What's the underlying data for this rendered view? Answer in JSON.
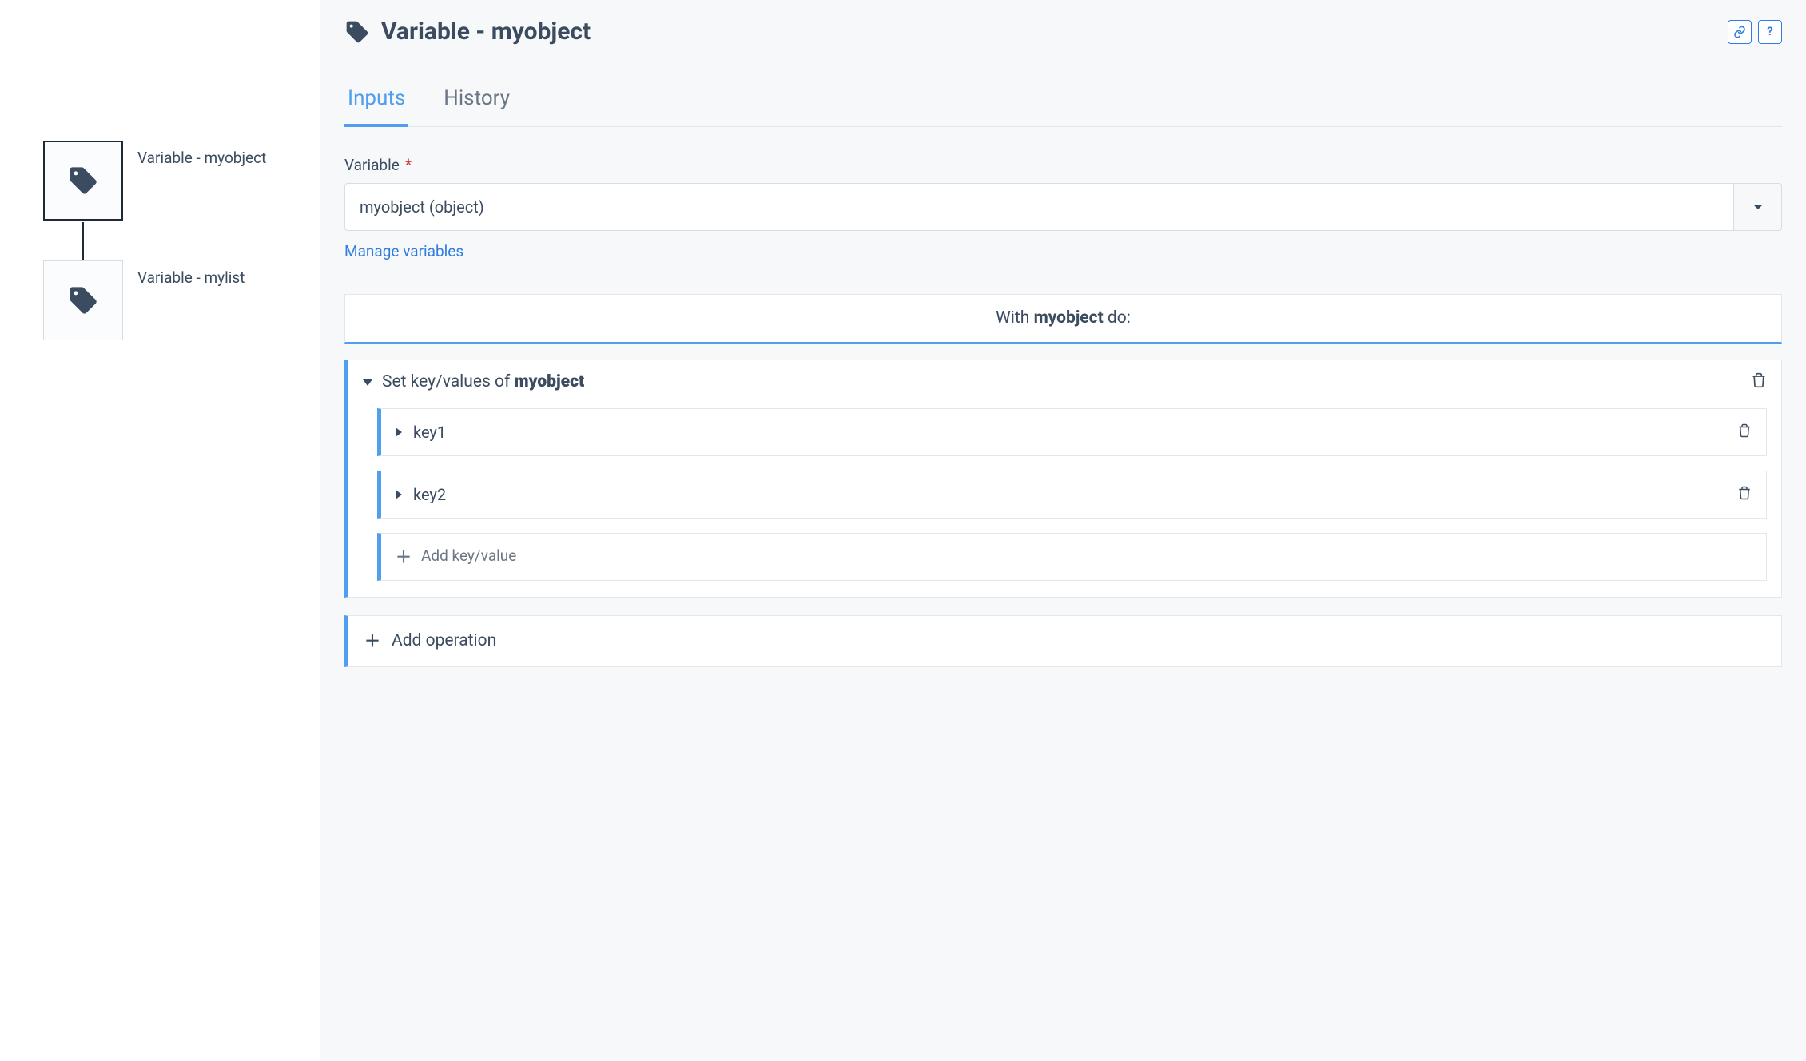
{
  "canvas": {
    "nodes": [
      {
        "id": "n1",
        "label": "Variable - myobject",
        "selected": true
      },
      {
        "id": "n2",
        "label": "Variable - mylist",
        "selected": false
      }
    ]
  },
  "header": {
    "title": "Variable - myobject",
    "link_btn_tooltip": "link",
    "help_btn_label": "?"
  },
  "tabs": {
    "active": "inputs",
    "inputs_label": "Inputs",
    "history_label": "History"
  },
  "form": {
    "variable_label": "Variable",
    "required_marker": "*",
    "variable_value": "myobject (object)",
    "manage_link": "Manage variables"
  },
  "withBlock": {
    "prefix": "With ",
    "objname": "myobject",
    "suffix": " do:"
  },
  "operation": {
    "title_prefix": "Set key/values of ",
    "title_obj": "myobject",
    "keys": [
      {
        "name": "key1"
      },
      {
        "name": "key2"
      }
    ],
    "add_kv_label": "Add key/value"
  },
  "add_operation_label": "Add operation"
}
